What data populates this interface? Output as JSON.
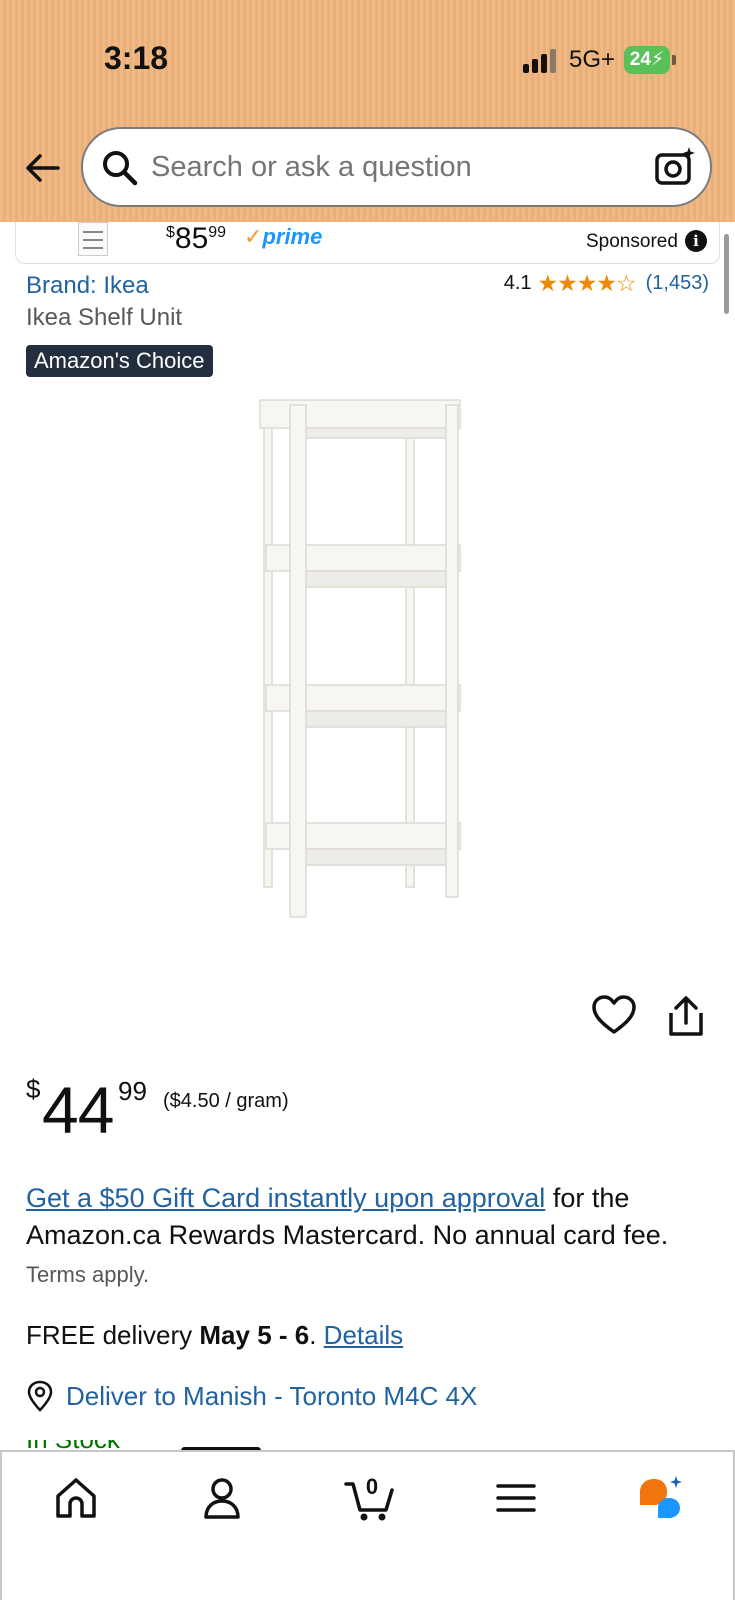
{
  "status_bar": {
    "time": "3:18",
    "network": "5G+",
    "battery": "24"
  },
  "search": {
    "placeholder": "Search or ask a question"
  },
  "sponsored": {
    "price_whole": "85",
    "price_fraction": "99",
    "price_currency": "$",
    "prime_label": "prime",
    "label": "Sponsored"
  },
  "product": {
    "brand": "Brand: Ikea",
    "rating": "4.1",
    "stars": "★★★★☆",
    "review_count": "(1,453)",
    "title": "Ikea Shelf Unit",
    "badge": "Amazon's Choice",
    "price_currency": "$",
    "price_whole": "44",
    "price_fraction": "99",
    "unit_price": "($4.50 / gram)"
  },
  "promo": {
    "link": "Get a $50 Gift Card instantly upon approval",
    "text": " for the Amazon.ca Rewards Mastercard. No annual card fee.",
    "terms": "Terms apply."
  },
  "delivery": {
    "prefix": "FREE delivery ",
    "dates": "May 5 - 6",
    "sep": ". ",
    "details": "Details",
    "deliver_to": "Deliver to Manish - Toronto M4C 4X",
    "stock": "In Stock"
  },
  "nav": {
    "cart_count": "0"
  },
  "colors": {
    "header": "#efb884",
    "link": "#2162a1",
    "star": "#f08804",
    "badge_bg": "#232f3e",
    "rufus_orange": "#f2740d",
    "rufus_blue": "#1a98ff"
  }
}
